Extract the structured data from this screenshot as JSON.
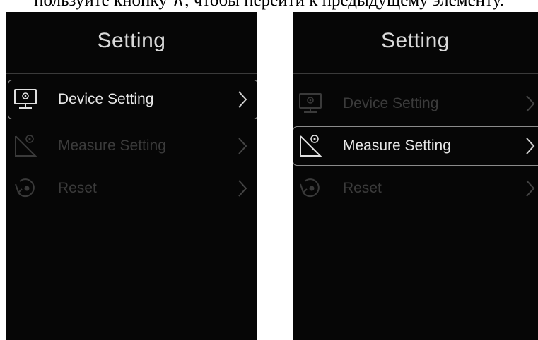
{
  "caption": "пользуйте кнопку ∧, чтобы перейти к предыдущему элементу.",
  "colors": {
    "screen_bg": "#060606",
    "active_text": "#e8e8e8",
    "inactive_text": "#3b3b3b",
    "selection_border": "#8a8a8a"
  },
  "screens": [
    {
      "title": "Setting",
      "selected_index": 0,
      "items": [
        {
          "label": "Device Setting",
          "icon": "monitor-icon",
          "selected": true
        },
        {
          "label": "Measure Setting",
          "icon": "ruler-triangle-icon",
          "selected": false
        },
        {
          "label": "Reset",
          "icon": "reset-icon",
          "selected": false
        }
      ]
    },
    {
      "title": "Setting",
      "selected_index": 1,
      "items": [
        {
          "label": "Device Setting",
          "icon": "monitor-icon",
          "selected": false
        },
        {
          "label": "Measure Setting",
          "icon": "ruler-triangle-icon",
          "selected": true
        },
        {
          "label": "Reset",
          "icon": "reset-icon",
          "selected": false
        }
      ]
    }
  ]
}
